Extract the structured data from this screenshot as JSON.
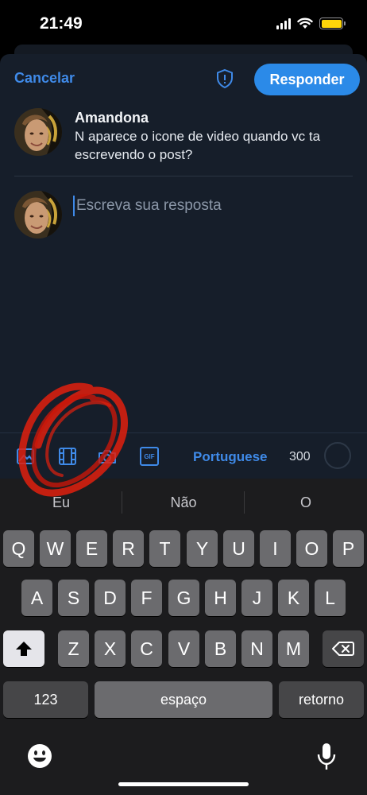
{
  "status_bar": {
    "time": "21:49"
  },
  "header": {
    "cancel_label": "Cancelar",
    "reply_label": "Responder"
  },
  "post": {
    "author": "Amandona",
    "text": "N aparece o icone de video quando vc ta escrevendo o post?"
  },
  "reply": {
    "placeholder": "Escreva sua resposta"
  },
  "toolbar": {
    "icons": [
      "image-icon",
      "video-icon",
      "camera-icon",
      "gif-icon"
    ],
    "gif_label": "GIF",
    "language": "Portuguese",
    "char_remaining": "300"
  },
  "keyboard": {
    "suggestions": [
      "Eu",
      "Não",
      "O"
    ],
    "row1": [
      "Q",
      "W",
      "E",
      "R",
      "T",
      "Y",
      "U",
      "I",
      "O",
      "P"
    ],
    "row2": [
      "A",
      "S",
      "D",
      "F",
      "G",
      "H",
      "J",
      "K",
      "L"
    ],
    "row3": [
      "Z",
      "X",
      "C",
      "V",
      "B",
      "N",
      "M"
    ],
    "numbers_label": "123",
    "space_label": "espaço",
    "return_label": "retorno"
  },
  "colors": {
    "accent": "#2b8ae8",
    "background": "#161e2a",
    "annotation": "#e0200e"
  }
}
